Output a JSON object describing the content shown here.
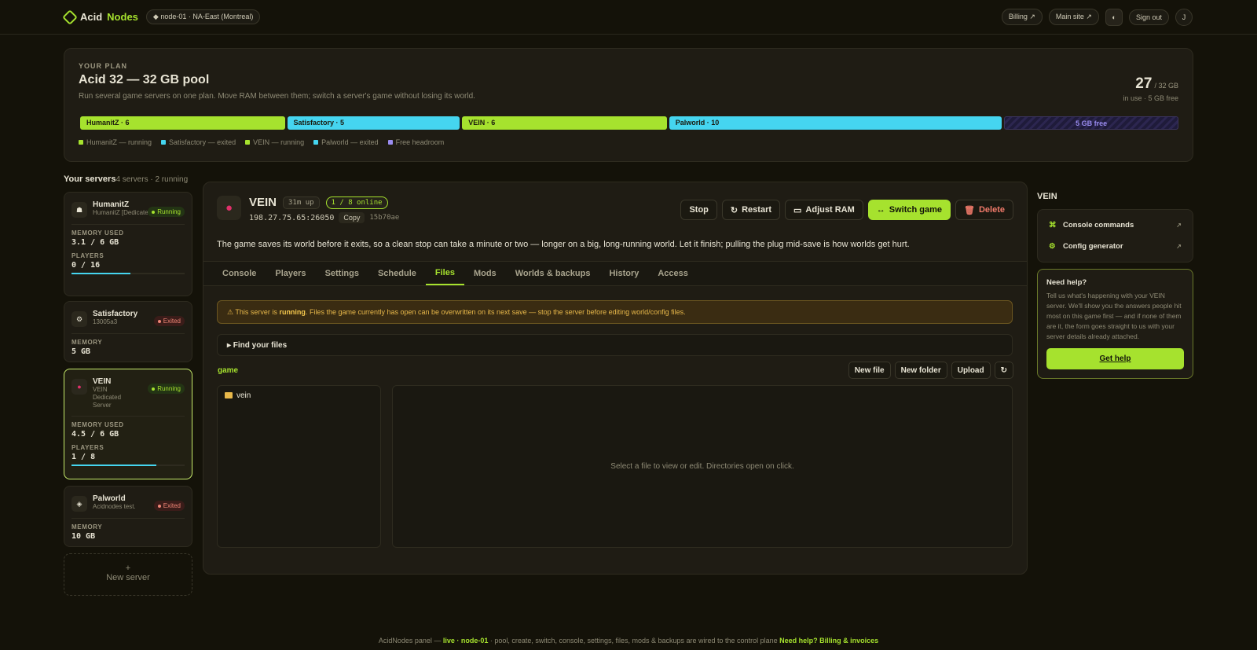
{
  "brand": {
    "name_a": "Acid",
    "name_b": "Nodes"
  },
  "node_pill": "◆ node-01 · NA-East (Montreal)",
  "top": {
    "billing": "Billing ↗",
    "main_site": "Main site ↗",
    "theme": "◐",
    "sign_out": "Sign out",
    "avatar": "J"
  },
  "plan": {
    "eyebrow": "YOUR PLAN",
    "title": "Acid 32 — 32 GB pool",
    "desc": "Run several game servers on one plan. Move RAM between them; switch a server's game without losing its world.",
    "used": "27",
    "total": "/ 32 GB",
    "sub": "in use · 5 GB free",
    "segments": [
      {
        "label": "HumanitZ · 6",
        "gb": 6
      },
      {
        "label": "Satisfactory · 5",
        "gb": 5
      },
      {
        "label": "VEIN · 6",
        "gb": 6
      },
      {
        "label": "Palworld · 10",
        "gb": 10
      },
      {
        "label": "5 GB free",
        "gb": 5
      }
    ],
    "legend": [
      "HumanitZ — running",
      "Satisfactory — exited",
      "VEIN — running",
      "Palworld — exited",
      "Free headroom"
    ],
    "colors": {
      "running": "#a6e22e",
      "exited": "#45d5f0",
      "free": "#9a8cf0"
    }
  },
  "servers_head": {
    "title": "Your servers",
    "sub": "4 servers · 2 running"
  },
  "servers": [
    {
      "name": "HumanitZ",
      "sub": "HumanitZ [Dedicated]",
      "status": "Running",
      "mem_label": "MEMORY USED",
      "mem": "3.1 / 6 GB",
      "players_label": "PLAYERS",
      "players": "0 / 16",
      "bar": 0.52
    },
    {
      "name": "Satisfactory",
      "sub": "13005a3",
      "status": "Exited",
      "mem_label": "MEMORY",
      "mem": "5 GB"
    },
    {
      "name": "VEIN",
      "sub": "VEIN Dedicated Server",
      "status": "Running",
      "mem_label": "MEMORY USED",
      "mem": "4.5 / 6 GB",
      "players_label": "PLAYERS",
      "players": "1 / 8",
      "bar": 0.75
    },
    {
      "name": "Palworld",
      "sub": "Acidnodes test.",
      "status": "Exited",
      "mem_label": "MEMORY",
      "mem": "10 GB"
    }
  ],
  "new_server": {
    "plus": "+",
    "label": "New server"
  },
  "detail": {
    "name": "VEIN",
    "uptime": "31m up",
    "online": "1 / 8 online",
    "addr": "198.27.75.65:26050",
    "copy": "Copy",
    "hash": "15b70ae",
    "actions": {
      "stop": "Stop",
      "restart": "Restart",
      "adjust": "Adjust RAM",
      "switch": "Switch game",
      "delete": "Delete"
    },
    "note": "The game saves its world before it exits, so a clean stop can take a minute or two — longer on a big, long-running world. Let it finish; pulling the plug mid-save is how worlds get hurt.",
    "tabs": [
      "Console",
      "Players",
      "Settings",
      "Schedule",
      "Files",
      "Mods",
      "Worlds & backups",
      "History",
      "Access"
    ],
    "warn_a": "This server is ",
    "warn_b": "running",
    "warn_c": ". Files the game currently has open can be overwritten on its next save — stop the server before editing world/config files.",
    "find": "▸ Find your files",
    "crumb": "game",
    "fbtns": {
      "new_file": "New file",
      "new_folder": "New folder",
      "upload": "Upload",
      "refresh": "↻"
    },
    "tree": [
      "vein"
    ],
    "viewer": "Select a file to view or edit. Directories open on click."
  },
  "side": {
    "title": "VEIN",
    "links": [
      "Console commands",
      "Config generator"
    ],
    "help_title": "Need help?",
    "help_desc": "Tell us what's happening with your VEIN server. We'll show you the answers people hit most on this game first — and if none of them are it, the form goes straight to us with your server details already attached.",
    "help_btn": "Get help"
  },
  "footer": {
    "a": "AcidNodes panel — ",
    "b": "live · node-01",
    "c": " · pool, create, switch, console, settings, files, mods & backups are wired to the control plane",
    "help": "Need help?",
    "billing": "Billing & invoices"
  }
}
